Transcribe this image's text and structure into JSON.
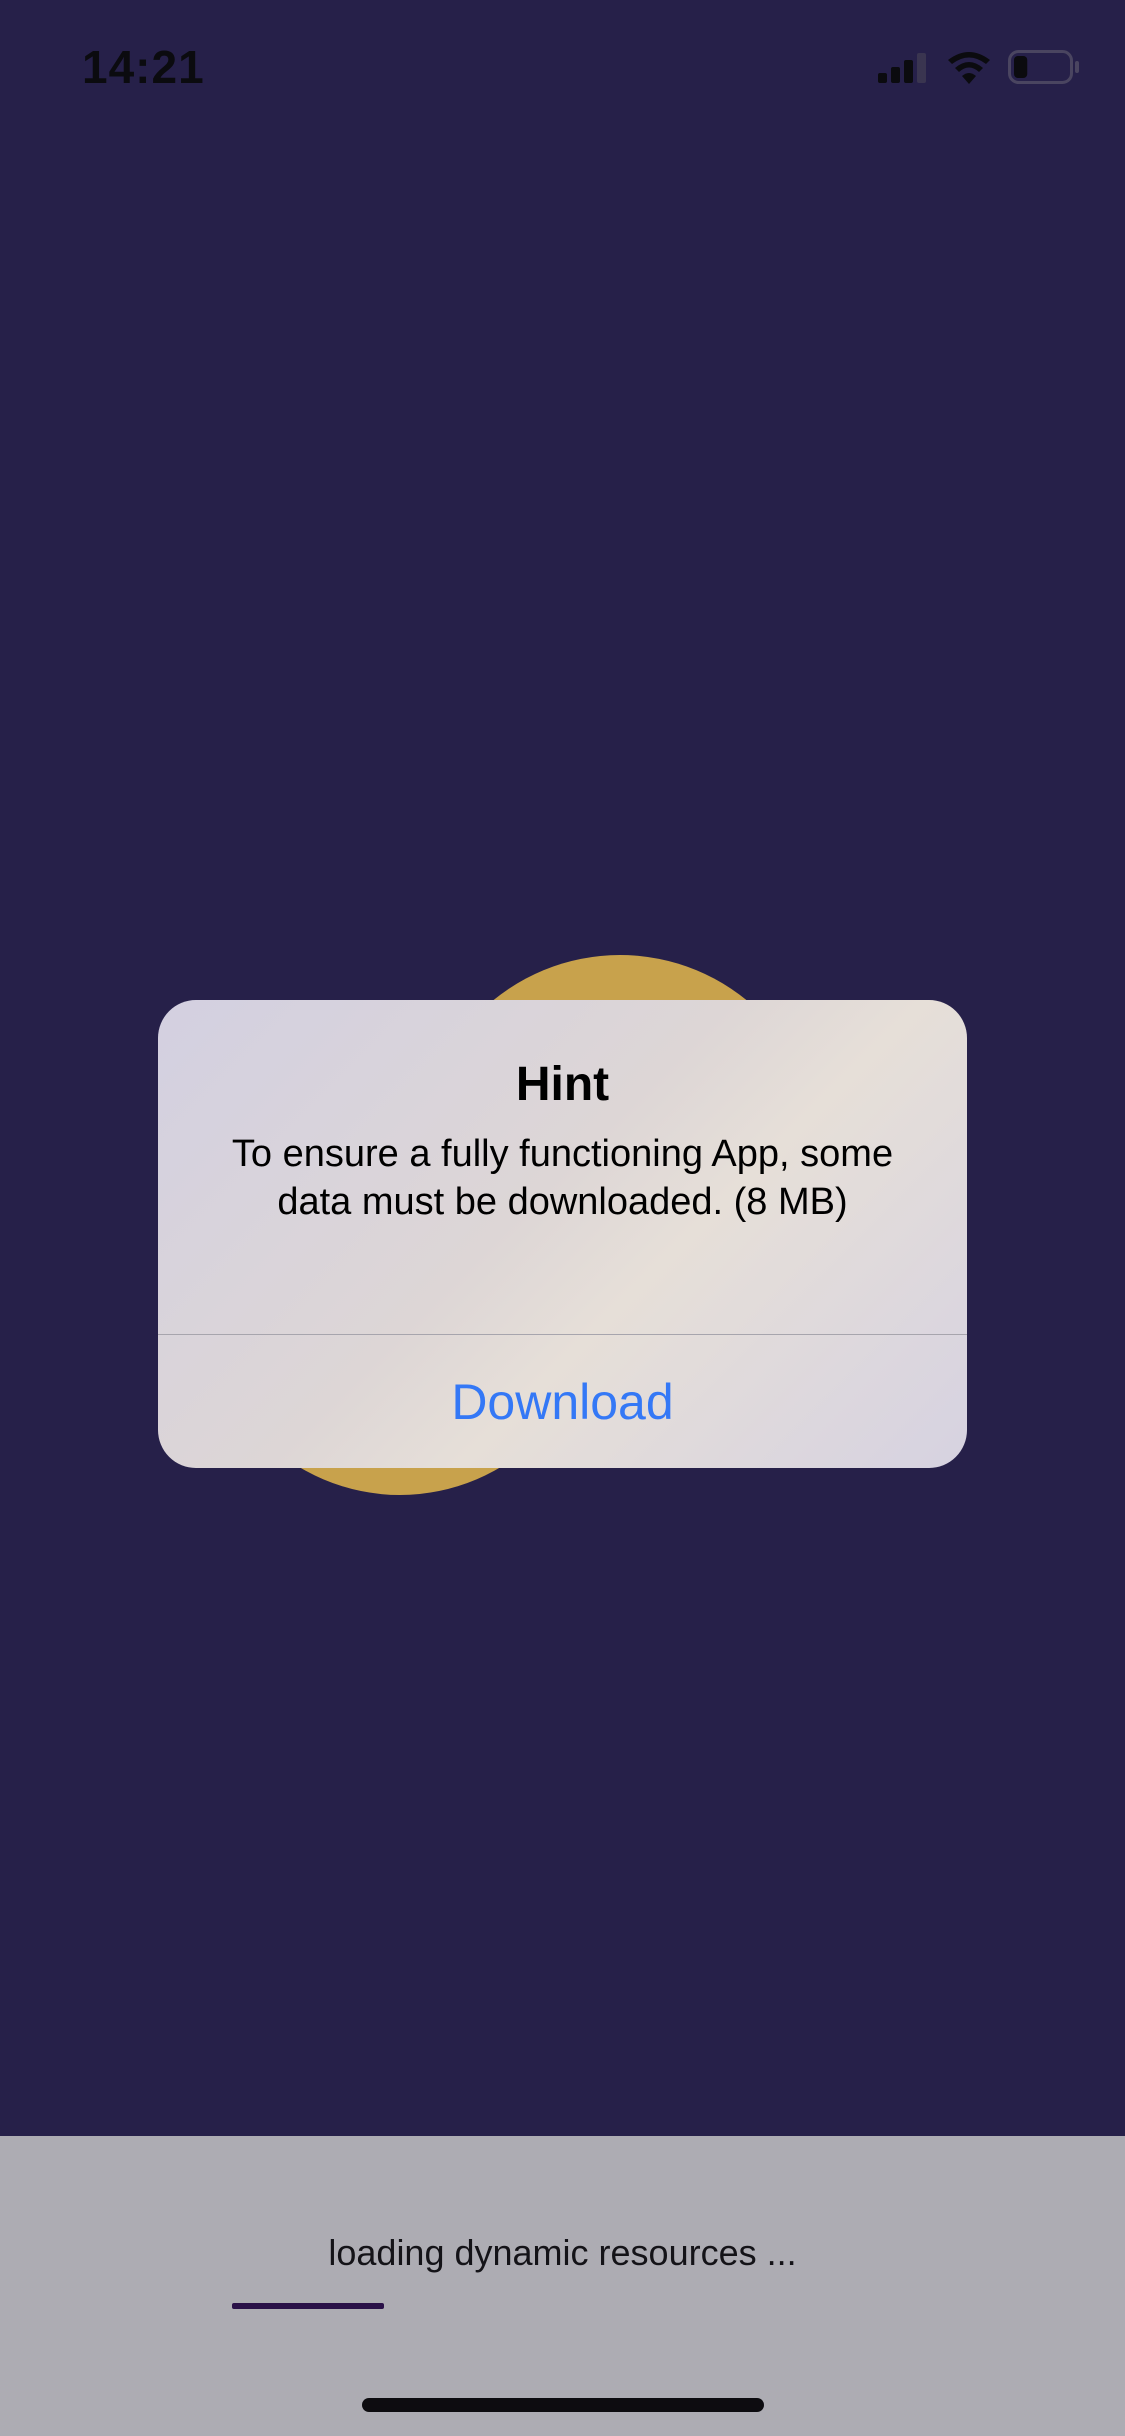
{
  "status_bar": {
    "time": "14:21",
    "icons": [
      "signal-icon",
      "wifi-icon",
      "battery-icon"
    ],
    "battery_level": 0.25
  },
  "alert": {
    "title": "Hint",
    "message": "To ensure a fully functioning App, some data must be downloaded. (8 MB)",
    "button_label": "Download"
  },
  "loading": {
    "text": "loading dynamic resources ...",
    "progress": 0.23
  },
  "colors": {
    "background": "#262049",
    "accent_button": "#3478f6",
    "artwork": "#c8a24c",
    "progress": "#2a1148"
  }
}
